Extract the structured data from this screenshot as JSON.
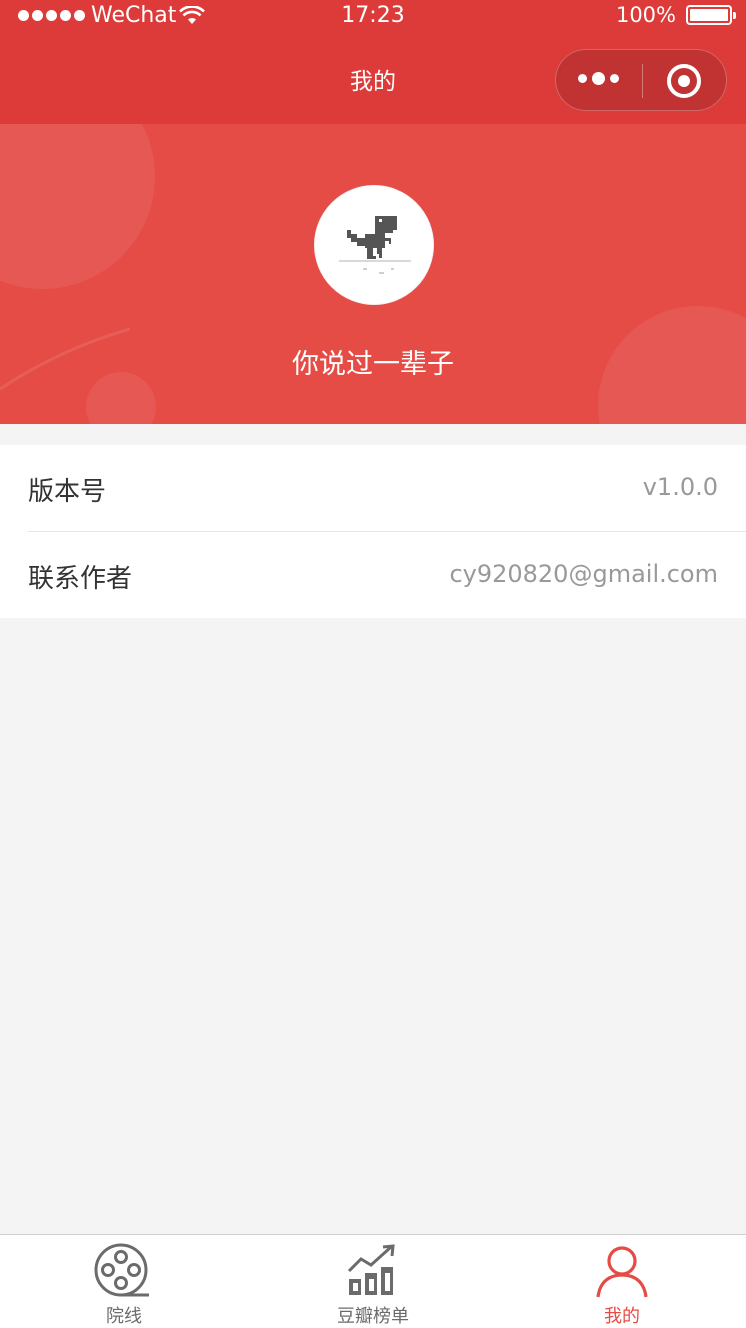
{
  "status_bar": {
    "carrier": "WeChat",
    "time": "17:23",
    "battery": "100%"
  },
  "nav": {
    "title": "我的"
  },
  "profile": {
    "nickname": "你说过一辈子"
  },
  "info_list": [
    {
      "label": "版本号",
      "value": "v1.0.0"
    },
    {
      "label": "联系作者",
      "value": "cy920820@gmail.com"
    }
  ],
  "tabbar": [
    {
      "label": "院线",
      "icon": "film-reel-icon",
      "active": false
    },
    {
      "label": "豆瓣榜单",
      "icon": "bar-chart-trend-icon",
      "active": false
    },
    {
      "label": "我的",
      "icon": "user-icon",
      "active": true
    }
  ],
  "colors": {
    "nav_red": "#dc3b3a",
    "banner_red": "#e54c46",
    "active_tab": "#e54c46"
  }
}
